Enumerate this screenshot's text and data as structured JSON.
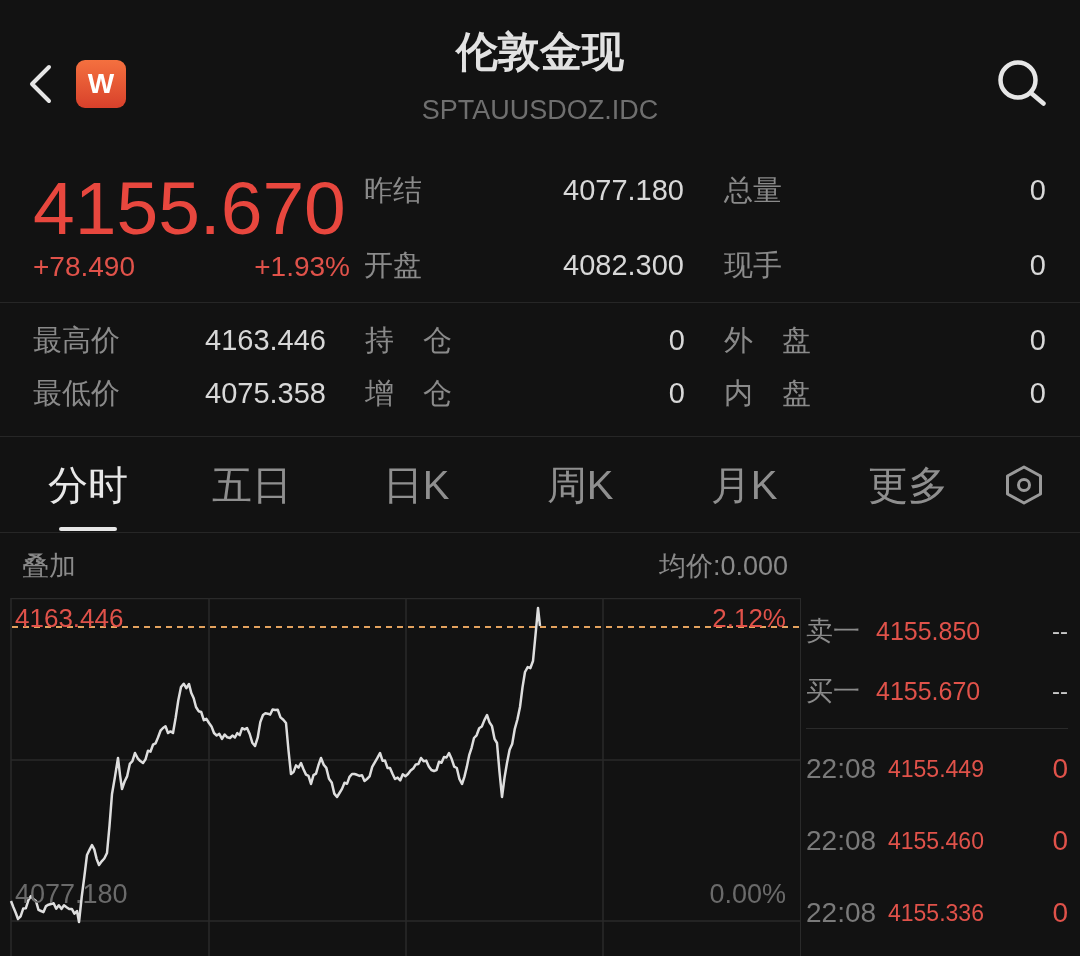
{
  "header": {
    "logo": "W",
    "title": "伦敦金现",
    "subtitle": "SPTAUUSDOZ.IDC"
  },
  "quote": {
    "price": "4155.670",
    "change": "+78.490",
    "change_percent": "+1.93%",
    "stats": [
      {
        "label": "昨结",
        "value": "4077.180"
      },
      {
        "label": "总量",
        "value": "0"
      },
      {
        "label": "开盘",
        "value": "4082.300"
      },
      {
        "label": "现手",
        "value": "0"
      }
    ]
  },
  "details": [
    {
      "cells": [
        {
          "label": "最高价",
          "value": "4163.446"
        },
        {
          "label": "持　仓",
          "value": "0"
        },
        {
          "label": "外　盘",
          "value": "0"
        }
      ]
    },
    {
      "cells": [
        {
          "label": "最低价",
          "value": "4075.358"
        },
        {
          "label": "增　仓",
          "value": "0"
        },
        {
          "label": "内　盘",
          "value": "0"
        }
      ]
    }
  ],
  "tabs": [
    {
      "label": "分时",
      "selected": true
    },
    {
      "label": "五日",
      "selected": false
    },
    {
      "label": "日K",
      "selected": false
    },
    {
      "label": "周K",
      "selected": false
    },
    {
      "label": "月K",
      "selected": false
    },
    {
      "label": "更多",
      "selected": false
    }
  ],
  "chart": {
    "overlay_button": "叠加",
    "average_price": "均价:0.000",
    "high_price": "4163.446",
    "high_percent": "2.12%",
    "base_price": "4077.180",
    "base_percent": "0.00%"
  },
  "order_book": [
    {
      "side": "卖一",
      "price": "4155.850",
      "volume": "--"
    },
    {
      "side": "买一",
      "price": "4155.670",
      "volume": "--"
    }
  ],
  "trades": [
    {
      "time": "22:08",
      "price": "4155.449",
      "volume": "0"
    },
    {
      "time": "22:08",
      "price": "4155.460",
      "volume": "0"
    },
    {
      "time": "22:08",
      "price": "4155.336",
      "volume": "0"
    }
  ]
}
